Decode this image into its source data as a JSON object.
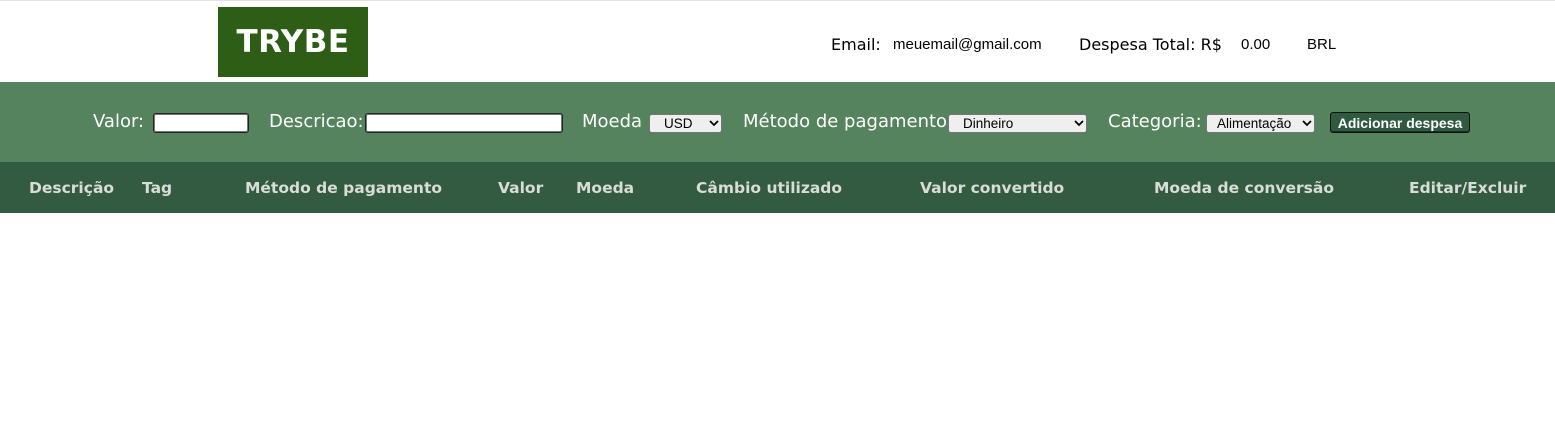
{
  "header": {
    "logo": "TRYBE",
    "email_label": "Email:",
    "email_value": "meuemail@gmail.com",
    "total_label": "Despesa Total: R$",
    "total_value": "0.00",
    "currency": "BRL"
  },
  "form": {
    "valor_label": "Valor:",
    "valor_value": "",
    "descricao_label": "Descricao:",
    "descricao_value": "",
    "moeda_label": "Moeda",
    "moeda_selected": "USD",
    "metodo_label": "Método de pagamento:",
    "metodo_selected": "Dinheiro",
    "categoria_label": "Categoria:",
    "categoria_selected": "Alimentação",
    "add_button": "Adicionar despesa"
  },
  "table": {
    "columns": [
      "Descrição",
      "Tag",
      "Método de pagamento",
      "Valor",
      "Moeda",
      "Câmbio utilizado",
      "Valor convertido",
      "Moeda de conversão",
      "Editar/Excluir"
    ]
  },
  "colors": {
    "logo_bg": "#2e5e16",
    "form_bar_bg": "#54835d",
    "table_head_bg": "#335b41",
    "button_bg": "#2f5a3f"
  },
  "icons": {
    "select_arrow": "chevron-down-icon"
  }
}
